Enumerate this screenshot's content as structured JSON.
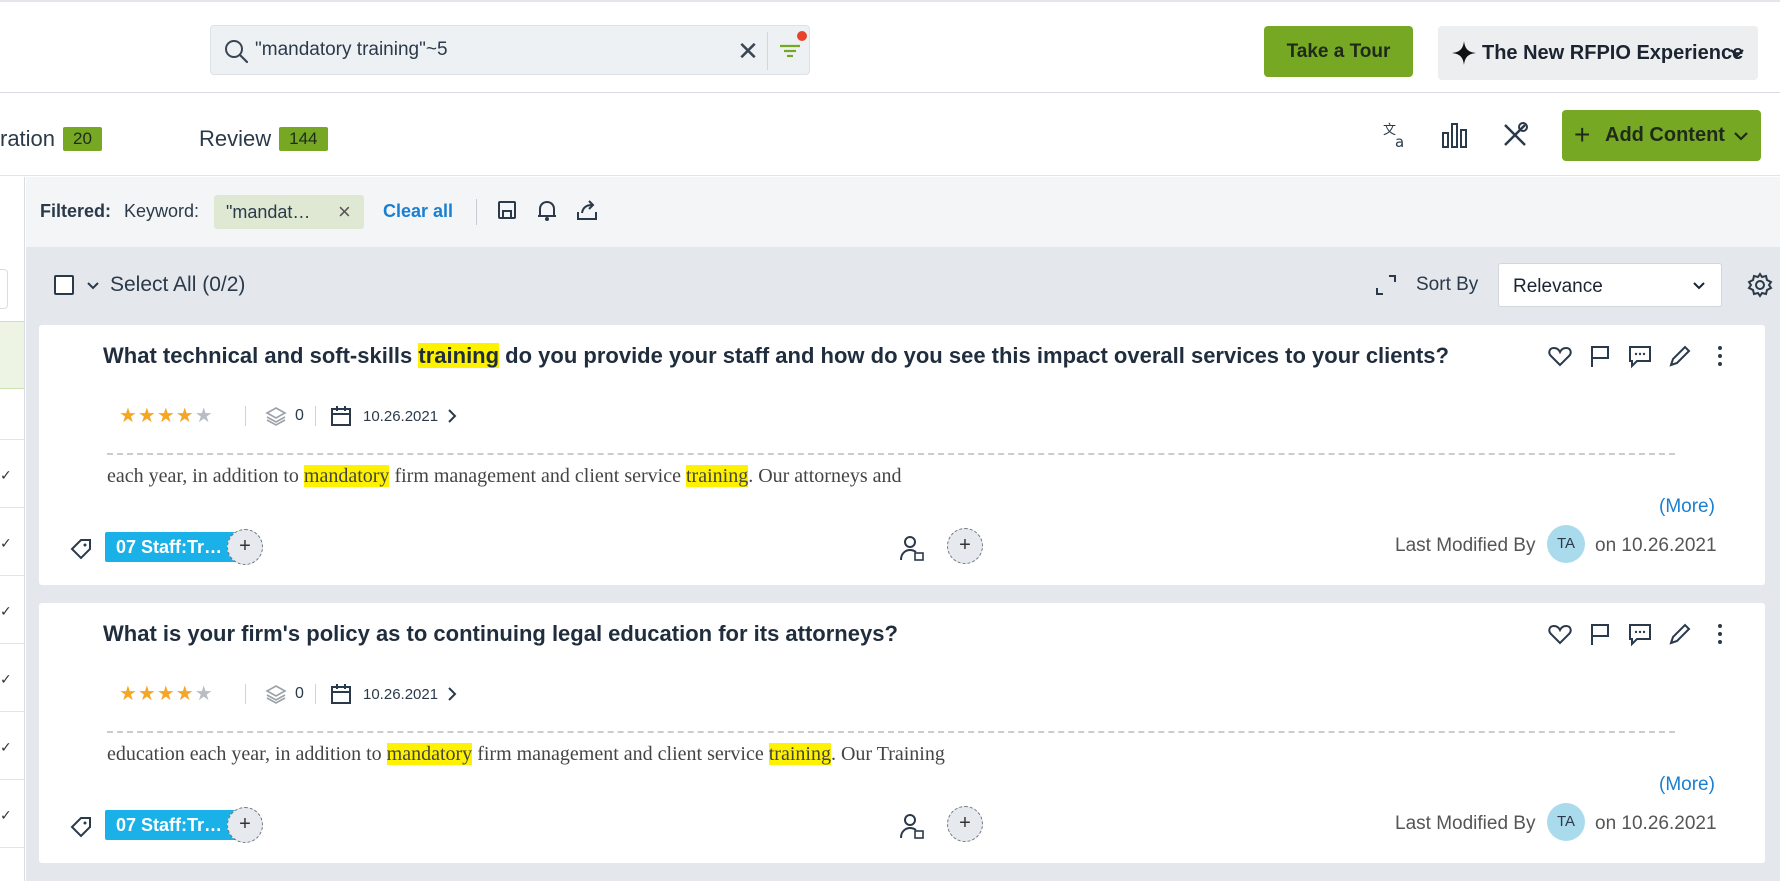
{
  "search": {
    "query": "\"mandatory training\"~5",
    "has_active_filter": true
  },
  "header": {
    "tour_label": "Take a Tour",
    "experience_label": "The New RFPIO Experience"
  },
  "tabs": [
    {
      "label": "ration",
      "count": "20"
    },
    {
      "label": "Review",
      "count": "144"
    }
  ],
  "toolbar": {
    "add_content_label": "Add Content"
  },
  "filters": {
    "filtered_label": "Filtered:",
    "keyword_label": "Keyword:",
    "keyword_chip": "\"mandat…",
    "clear_all_label": "Clear all"
  },
  "results": {
    "select_all_label": "Select All (0/2)",
    "sort_by_label": "Sort By",
    "sort_value": "Relevance",
    "items": [
      {
        "q_pre": "What technical and soft-skills ",
        "q_hl": "training",
        "q_post": " do you provide your staff and how do you see this impact overall services to your clients?",
        "rating": 4,
        "star_on": "★★★★",
        "star_off": "★",
        "layers": "0",
        "date": "10.26.2021",
        "a_pre": "each year, in addition to ",
        "a_hl1": "mandatory",
        "a_mid": " firm management and client service ",
        "a_hl2": "training",
        "a_post": ". Our attorneys and",
        "more": "(More)",
        "tag": "07 Staff:Tr…",
        "last_modified_label": "Last Modified By",
        "initials": "TA",
        "on_label": "on",
        "modified_date": "10.26.2021"
      },
      {
        "q_pre": "What is your firm's policy as to continuing legal education for its attorneys?",
        "rating": 4,
        "star_on": "★★★★",
        "star_off": "★",
        "layers": "0",
        "date": "10.26.2021",
        "a_pre": "education each year, in addition to ",
        "a_hl1": "mandatory",
        "a_mid": " firm management and client service ",
        "a_hl2": "training",
        "a_post": ". Our Training",
        "more": "(More)",
        "tag": "07 Staff:Tr…",
        "last_modified_label": "Last Modified By",
        "initials": "TA",
        "on_label": "on",
        "modified_date": "10.26.2021"
      }
    ]
  },
  "colors": {
    "accent_green": "#76a824",
    "link_blue": "#1a7fd1",
    "tag_blue": "#1ab0e8",
    "highlight": "#fff200",
    "star": "#f5a623"
  }
}
